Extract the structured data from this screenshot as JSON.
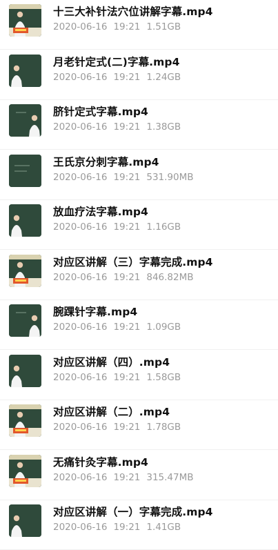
{
  "files": [
    {
      "name": "十三大补针法穴位讲解字幕.mp4",
      "date": "2020-06-16",
      "time": "19:21",
      "size": "1.51GB",
      "thumb": "stage"
    },
    {
      "name": "月老针定式(二)字幕.mp4",
      "date": "2020-06-16",
      "time": "19:21",
      "size": "1.24GB",
      "thumb": "lecturer-left"
    },
    {
      "name": "脐针定式字幕.mp4",
      "date": "2020-06-16",
      "time": "19:21",
      "size": "1.38GB",
      "thumb": "lecturer-right"
    },
    {
      "name": "王氏京分刺字幕.mp4",
      "date": "2020-06-16",
      "time": "19:21",
      "size": "531.90MB",
      "thumb": "board"
    },
    {
      "name": "放血疗法字幕.mp4",
      "date": "2020-06-16",
      "time": "19:21",
      "size": "1.16GB",
      "thumb": "lecturer-left"
    },
    {
      "name": "对应区讲解（三）字幕完成.mp4",
      "date": "2020-06-16",
      "time": "19:21",
      "size": "846.82MB",
      "thumb": "stage"
    },
    {
      "name": "腕踝针字幕.mp4",
      "date": "2020-06-16",
      "time": "19:21",
      "size": "1.09GB",
      "thumb": "lecturer-right"
    },
    {
      "name": "对应区讲解（四）.mp4",
      "date": "2020-06-16",
      "time": "19:21",
      "size": "1.58GB",
      "thumb": "lecturer-left"
    },
    {
      "name": "对应区讲解（二）.mp4",
      "date": "2020-06-16",
      "time": "19:21",
      "size": "1.78GB",
      "thumb": "stage"
    },
    {
      "name": "无痛针灸字幕.mp4",
      "date": "2020-06-16",
      "time": "19:21",
      "size": "315.47MB",
      "thumb": "stage"
    },
    {
      "name": "对应区讲解（一）字幕完成.mp4",
      "date": "2020-06-16",
      "time": "19:21",
      "size": "1.41GB",
      "thumb": "lecturer-left"
    }
  ]
}
